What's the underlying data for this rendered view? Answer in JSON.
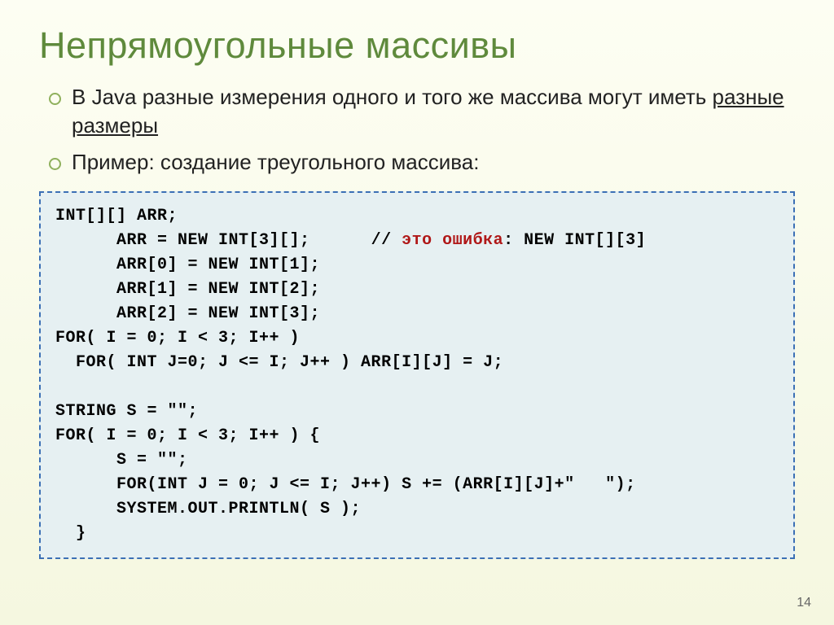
{
  "title": "Непрямоугольные массивы",
  "bullets": [
    {
      "pre": "В Java разные измерения одного и того же массива могут иметь ",
      "u": "разные размеры",
      "post": ""
    },
    {
      "pre": "Пример: создание треугольного массива:",
      "u": "",
      "post": ""
    }
  ],
  "code": {
    "l01": "INT[][] ARR;",
    "l02": "      ARR = NEW INT[3][];      ",
    "l02c": "// ",
    "l02e": "это ошибка",
    "l02t": ": NEW INT[][3]",
    "l03": "      ARR[0] = NEW INT[1];",
    "l04": "      ARR[1] = NEW INT[2];",
    "l05": "      ARR[2] = NEW INT[3];",
    "l06": "FOR( I = 0; I < 3; I++ )",
    "l07": "  FOR( INT J=0; J <= I; J++ ) ARR[I][J] = J;",
    "l08": "",
    "l09": "STRING S = \"\";",
    "l10": "FOR( I = 0; I < 3; I++ ) {",
    "l11": "      S = \"\";",
    "l12": "      FOR(INT J = 0; J <= I; J++) S += (ARR[I][J]+\"   \");",
    "l13": "      SYSTEM.OUT.PRINTLN( S );",
    "l14": "  }"
  },
  "page": "14"
}
